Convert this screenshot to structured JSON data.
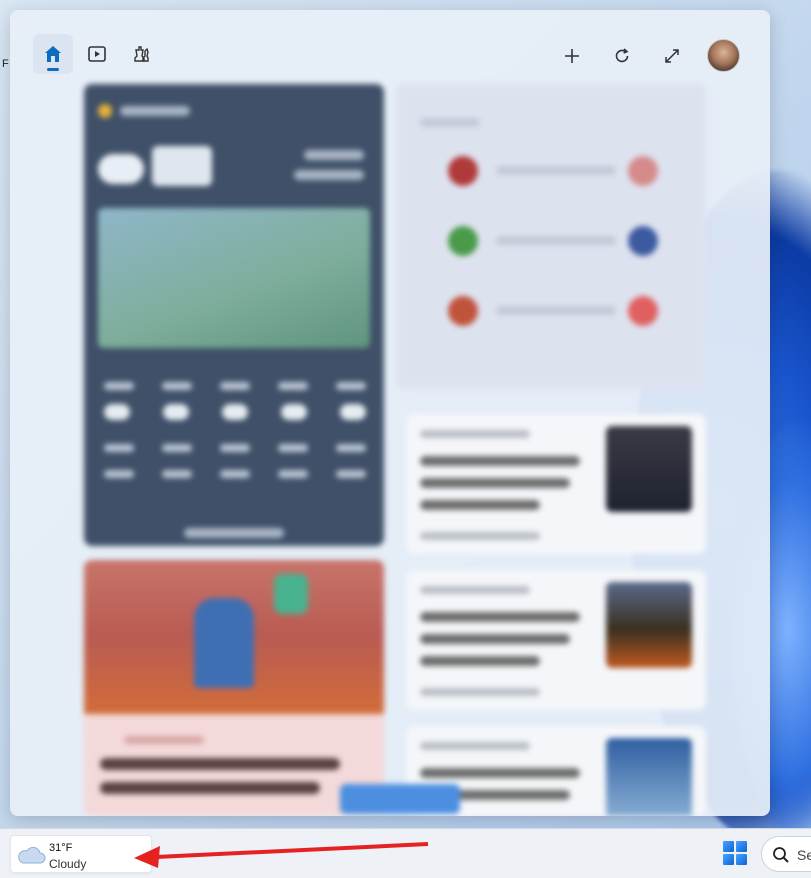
{
  "desktop": {
    "edge_text": "F"
  },
  "widgets_panel": {
    "tabs": [
      {
        "icon": "home-icon",
        "active": true
      },
      {
        "icon": "video-icon",
        "active": false
      },
      {
        "icon": "game-icon",
        "active": false
      }
    ],
    "header_buttons": [
      {
        "icon": "add-icon"
      },
      {
        "icon": "refresh-icon"
      },
      {
        "icon": "expand-icon"
      }
    ],
    "feed_blurred": true
  },
  "taskbar": {
    "weather": {
      "temperature": "31°F",
      "condition": "Cloudy",
      "icon": "cloud-icon"
    },
    "start_icon": "windows-start-icon",
    "search": {
      "icon": "search-icon",
      "text": "Se"
    }
  },
  "annotation": {
    "type": "arrow",
    "color": "#e52222",
    "points_to": "taskbar weather widget"
  },
  "colors": {
    "accent": "#0f6cbd",
    "arrow": "#e52222",
    "taskbar": "#eef1f6"
  }
}
